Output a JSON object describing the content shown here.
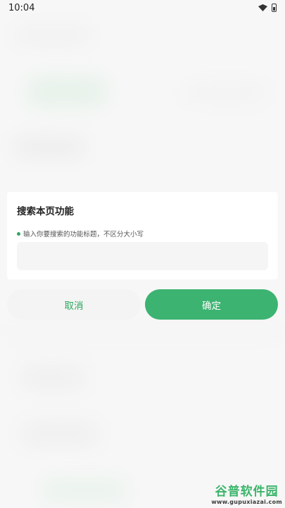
{
  "status_bar": {
    "time": "10:04"
  },
  "dialog": {
    "title": "搜索本页功能",
    "hint": "输入你要搜索的功能标题，不区分大小写",
    "input_value": ""
  },
  "buttons": {
    "cancel_label": "取消",
    "confirm_label": "确定"
  },
  "watermark": {
    "logo_text": "谷普软件园",
    "url": "www.gupuxiazai.com"
  },
  "colors": {
    "accent": "#3cb371",
    "accent_text": "#2fa85f"
  }
}
